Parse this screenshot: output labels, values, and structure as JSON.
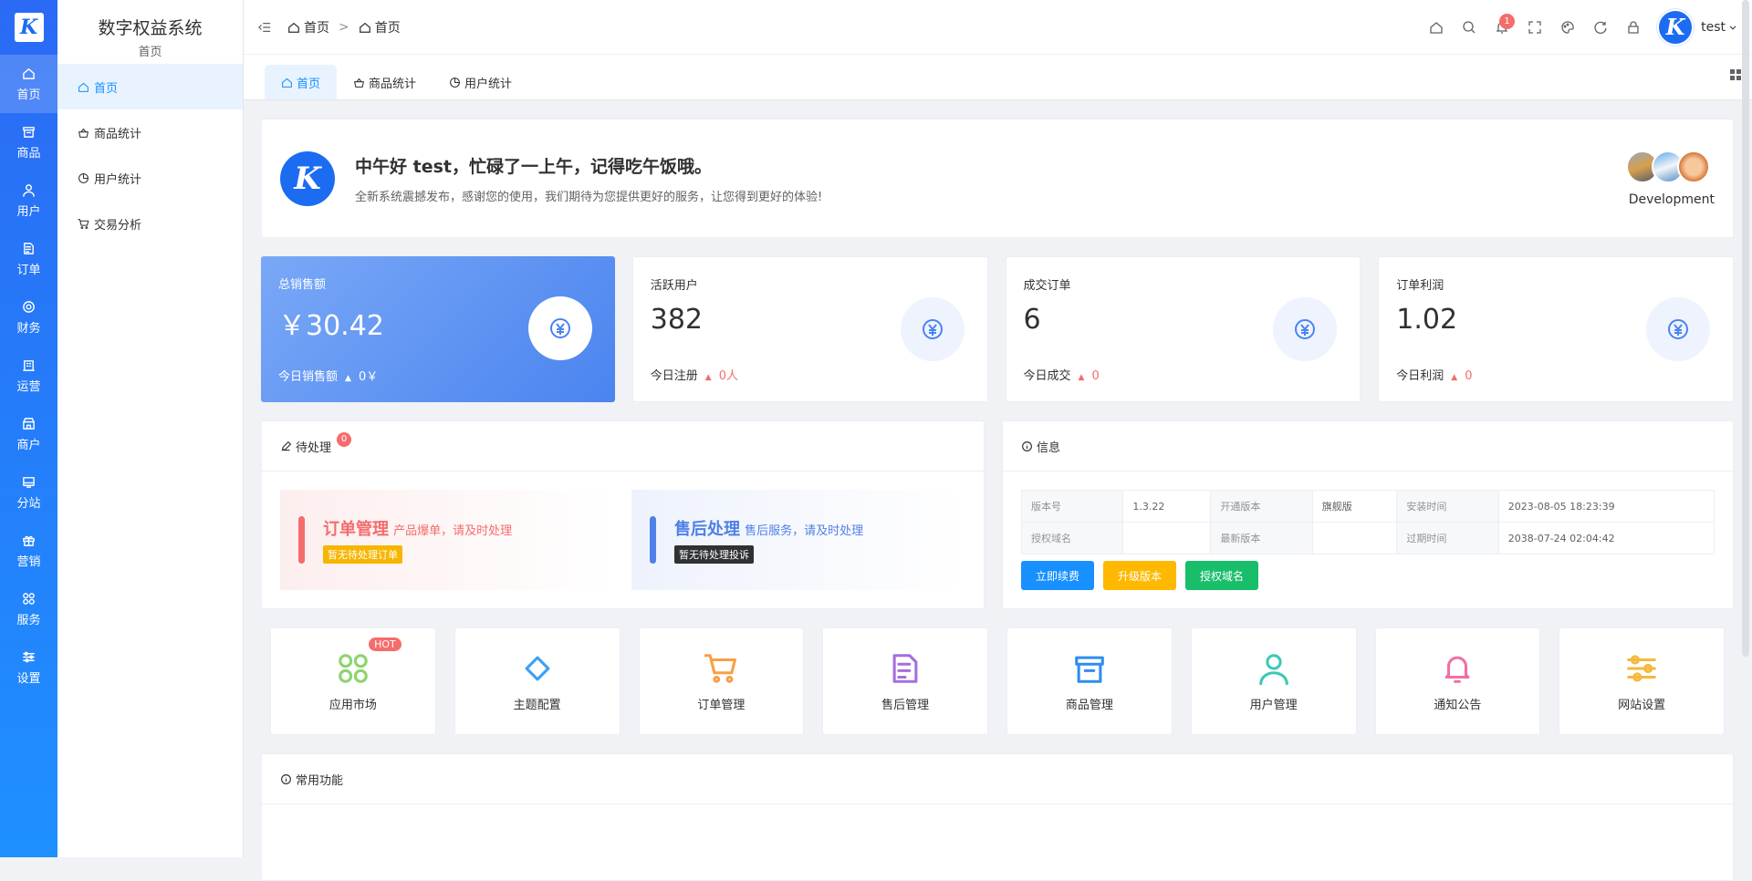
{
  "rail": {
    "logo": "K",
    "items": [
      {
        "label": "首页",
        "icon": "home-icon"
      },
      {
        "label": "商品",
        "icon": "box-icon"
      },
      {
        "label": "用户",
        "icon": "user-icon"
      },
      {
        "label": "订单",
        "icon": "document-icon"
      },
      {
        "label": "财务",
        "icon": "finance-icon"
      },
      {
        "label": "运营",
        "icon": "building-icon"
      },
      {
        "label": "商户",
        "icon": "shop-icon"
      },
      {
        "label": "分站",
        "icon": "site-icon"
      },
      {
        "label": "营销",
        "icon": "gift-icon"
      },
      {
        "label": "服务",
        "icon": "apps-icon"
      },
      {
        "label": "设置",
        "icon": "sliders-icon"
      }
    ]
  },
  "sidebar": {
    "title": "数字权益系统",
    "caption": "首页",
    "items": [
      {
        "label": "首页",
        "icon": "home-icon"
      },
      {
        "label": "商品统计",
        "icon": "basket-icon"
      },
      {
        "label": "用户统计",
        "icon": "pie-icon"
      },
      {
        "label": "交易分析",
        "icon": "cart-icon"
      }
    ]
  },
  "header": {
    "breadcrumb": [
      "首页",
      "首页"
    ],
    "breadcrumb_sep": ">",
    "notification_count": "1",
    "username": "test",
    "icons": [
      "home-icon",
      "search-icon",
      "bell-icon",
      "fullscreen-icon",
      "palette-icon",
      "refresh-icon",
      "lock-icon"
    ]
  },
  "tabs": [
    {
      "label": "首页",
      "icon": "home-icon"
    },
    {
      "label": "商品统计",
      "icon": "basket-icon"
    },
    {
      "label": "用户统计",
      "icon": "pie-icon"
    }
  ],
  "welcome": {
    "title": "中午好 test，忙碌了一上午，记得吃午饭哦。",
    "subtitle": "全新系统震撼发布，感谢您的使用，我们期待为您提供更好的服务，让您得到更好的体验!",
    "team_label": "Development"
  },
  "stats": [
    {
      "label": "总销售额",
      "value": "￥30.42",
      "foot_label": "今日销售额",
      "foot_value": "0￥"
    },
    {
      "label": "活跃用户",
      "value": "382",
      "foot_label": "今日注册",
      "foot_value": "0人"
    },
    {
      "label": "成交订单",
      "value": "6",
      "foot_label": "今日成交",
      "foot_value": "0"
    },
    {
      "label": "订单利润",
      "value": "1.02",
      "foot_label": "今日利润",
      "foot_value": "0"
    }
  ],
  "pending": {
    "title": "待处理",
    "badge": "0",
    "items": [
      {
        "title": "订单管理",
        "desc": "产品爆单，请及时处理",
        "tag": "暂无待处理订单",
        "color": "#f56c6c",
        "tag_color": "#f7b500"
      },
      {
        "title": "售后处理",
        "desc": "售后服务，请及时处理",
        "tag": "暂无待处理投诉",
        "color": "#4f80e6",
        "tag_color": "#303133"
      }
    ]
  },
  "info": {
    "title": "信息",
    "rows": [
      [
        "版本号",
        "1.3.22",
        "开通版本",
        "旗舰版",
        "安装时间",
        "2023-08-05 18:23:39"
      ],
      [
        "授权域名",
        "",
        "最新版本",
        "",
        "过期时间",
        "2038-07-24 02:04:42"
      ]
    ],
    "buttons": [
      {
        "label": "立即续费",
        "color": "#1890ff"
      },
      {
        "label": "升级版本",
        "color": "#ffb800"
      },
      {
        "label": "授权域名",
        "color": "#19be6b"
      }
    ]
  },
  "shortcuts": [
    {
      "label": "应用市场",
      "icon": "apps-icon",
      "color": "#8bd46e",
      "hot": "HOT"
    },
    {
      "label": "主题配置",
      "icon": "theme-icon",
      "color": "#3da0f5"
    },
    {
      "label": "订单管理",
      "icon": "cart-icon",
      "color": "#f7a046"
    },
    {
      "label": "售后管理",
      "icon": "document-icon",
      "color": "#a56fde"
    },
    {
      "label": "商品管理",
      "icon": "box-icon",
      "color": "#2f8cf0"
    },
    {
      "label": "用户管理",
      "icon": "user-icon",
      "color": "#3cc9b4"
    },
    {
      "label": "通知公告",
      "icon": "bell-icon",
      "color": "#f26da6"
    },
    {
      "label": "网站设置",
      "icon": "sliders-icon",
      "color": "#f5b93e"
    }
  ],
  "common": {
    "title": "常用功能"
  }
}
